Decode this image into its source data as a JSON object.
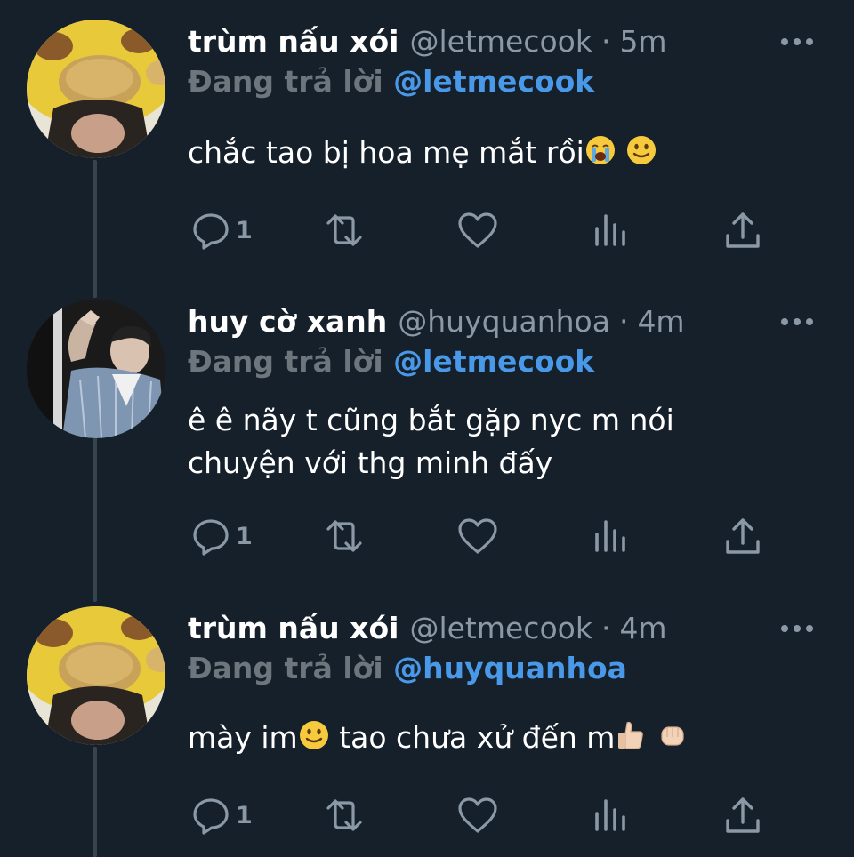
{
  "colors": {
    "background": "#15202b",
    "muted": "#8b98a5",
    "mention": "#4a99e9",
    "thread_line": "#38444d"
  },
  "tweets": [
    {
      "display_name": "trùm nấu xói",
      "handle": "@letmecook",
      "dot": "·",
      "time": "5m",
      "reply_prefix": "Đang trả lời",
      "reply_to": "@letmecook",
      "text": "chắc tao bị hoa mẹ mắt rồi",
      "emojis": [
        "loudly-crying-face-emoji",
        "slightly-smiling-face-emoji"
      ],
      "reply_count": "1",
      "avatar": "yellow-plush-hat-avatar"
    },
    {
      "display_name": "huy cờ xanh",
      "handle": "@huyquanhoa",
      "dot": "·",
      "time": "4m",
      "reply_prefix": "Đang trả lời",
      "reply_to": "@letmecook",
      "text_line1": "ê ê nãy t cũng bắt gặp nyc m nói",
      "text_line2": "chuyện với thg minh đấy",
      "reply_count": "1",
      "avatar": "denim-jacket-photo-avatar"
    },
    {
      "display_name": "trùm nấu xói",
      "handle": "@letmecook",
      "dot": "·",
      "time": "4m",
      "reply_prefix": "Đang trả lời",
      "reply_to": "@huyquanhoa",
      "text_a": "mày im",
      "text_b": " tao chưa xử đến m",
      "emojis": [
        "slightly-smiling-face-emoji",
        "thumbs-up-emoji",
        "fist-bump-emoji"
      ],
      "reply_count": "1",
      "avatar": "yellow-plush-hat-avatar"
    }
  ]
}
